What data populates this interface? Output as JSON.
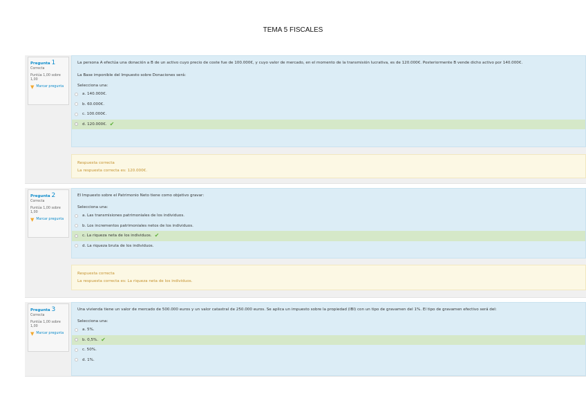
{
  "page_title": "TEMA 5 FISCALES",
  "questions": [
    {
      "label": "Pregunta",
      "number": "1",
      "state": "Correcta",
      "grade": "Puntúa 1,00 sobre 1,00",
      "flag": "Marcar pregunta",
      "text": "La persona A efectúa una donación a B de un activo cuyo precio de coste fue de 100.000€, y cuyo valor de mercado, en el momento de la transmisión lucrativa, es de 120.000€. Posteriormente B vende dicho activo por 140.000€.",
      "text2": "La Base imponible del Impuesto sobre Donaciones será:",
      "prompt": "Selecciona una:",
      "options": [
        "a. 140.000€.",
        "b. 60.000€.",
        "c. 100.000€.",
        "d. 120.000€."
      ],
      "selected_index": 3,
      "outcome_title": "Respuesta correcta",
      "outcome_text": "La respuesta correcta es: 120.000€."
    },
    {
      "label": "Pregunta",
      "number": "2",
      "state": "Correcta",
      "grade": "Puntúa 1,00 sobre 1,00",
      "flag": "Marcar pregunta",
      "text": "El Impuesto sobre el Patrimonio Neto tiene como objetivo gravar:",
      "prompt": "Selecciona una:",
      "options": [
        "a. Las transmisiones patrimoniales de los individuos.",
        "b. Los incrementos patrimoniales netos de los individuos.",
        "c. La riqueza neta de los individuos.",
        "d. La riqueza bruta de los individuos."
      ],
      "selected_index": 2,
      "outcome_title": "Respuesta correcta",
      "outcome_text": "La respuesta correcta es: La riqueza neta de los individuos."
    },
    {
      "label": "Pregunta",
      "number": "3",
      "state": "Correcta",
      "grade": "Puntúa 1,00 sobre 1,00",
      "flag": "Marcar pregunta",
      "text": "Una vivienda tiene un valor de mercado de 500.000 euros y un valor catastral de 250.000 euros. Se aplica un impuesto sobre la propiedad (IBI) con un tipo de gravamen del 1%. El tipo de gravamen efectivo será del:",
      "prompt": "Selecciona una:",
      "options": [
        "a. 5%.",
        "b. 0,5%.",
        "c. 50%.",
        "d. 1%."
      ],
      "selected_index": 1
    }
  ],
  "icons": {
    "flag": "flag-icon",
    "correct": "check-icon"
  },
  "colors": {
    "link": "#0a8acb",
    "question_bg": "#dcedf6",
    "correct_bg": "#d5e8c8",
    "feedback_bg": "#fcf8e4",
    "feedback_text": "#c3912e",
    "check": "#5fb03a"
  }
}
